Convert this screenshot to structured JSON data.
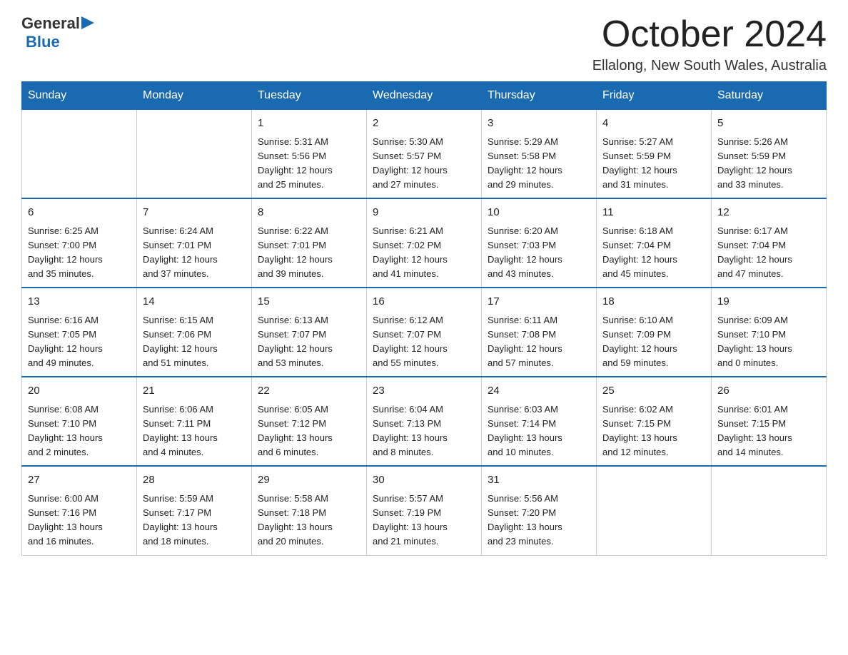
{
  "header": {
    "logo": {
      "general": "General",
      "arrow": "▶",
      "blue": "Blue"
    },
    "month_title": "October 2024",
    "location": "Ellalong, New South Wales, Australia"
  },
  "days_of_week": [
    "Sunday",
    "Monday",
    "Tuesday",
    "Wednesday",
    "Thursday",
    "Friday",
    "Saturday"
  ],
  "weeks": [
    [
      {
        "day": "",
        "info": ""
      },
      {
        "day": "",
        "info": ""
      },
      {
        "day": "1",
        "info": "Sunrise: 5:31 AM\nSunset: 5:56 PM\nDaylight: 12 hours\nand 25 minutes."
      },
      {
        "day": "2",
        "info": "Sunrise: 5:30 AM\nSunset: 5:57 PM\nDaylight: 12 hours\nand 27 minutes."
      },
      {
        "day": "3",
        "info": "Sunrise: 5:29 AM\nSunset: 5:58 PM\nDaylight: 12 hours\nand 29 minutes."
      },
      {
        "day": "4",
        "info": "Sunrise: 5:27 AM\nSunset: 5:59 PM\nDaylight: 12 hours\nand 31 minutes."
      },
      {
        "day": "5",
        "info": "Sunrise: 5:26 AM\nSunset: 5:59 PM\nDaylight: 12 hours\nand 33 minutes."
      }
    ],
    [
      {
        "day": "6",
        "info": "Sunrise: 6:25 AM\nSunset: 7:00 PM\nDaylight: 12 hours\nand 35 minutes."
      },
      {
        "day": "7",
        "info": "Sunrise: 6:24 AM\nSunset: 7:01 PM\nDaylight: 12 hours\nand 37 minutes."
      },
      {
        "day": "8",
        "info": "Sunrise: 6:22 AM\nSunset: 7:01 PM\nDaylight: 12 hours\nand 39 minutes."
      },
      {
        "day": "9",
        "info": "Sunrise: 6:21 AM\nSunset: 7:02 PM\nDaylight: 12 hours\nand 41 minutes."
      },
      {
        "day": "10",
        "info": "Sunrise: 6:20 AM\nSunset: 7:03 PM\nDaylight: 12 hours\nand 43 minutes."
      },
      {
        "day": "11",
        "info": "Sunrise: 6:18 AM\nSunset: 7:04 PM\nDaylight: 12 hours\nand 45 minutes."
      },
      {
        "day": "12",
        "info": "Sunrise: 6:17 AM\nSunset: 7:04 PM\nDaylight: 12 hours\nand 47 minutes."
      }
    ],
    [
      {
        "day": "13",
        "info": "Sunrise: 6:16 AM\nSunset: 7:05 PM\nDaylight: 12 hours\nand 49 minutes."
      },
      {
        "day": "14",
        "info": "Sunrise: 6:15 AM\nSunset: 7:06 PM\nDaylight: 12 hours\nand 51 minutes."
      },
      {
        "day": "15",
        "info": "Sunrise: 6:13 AM\nSunset: 7:07 PM\nDaylight: 12 hours\nand 53 minutes."
      },
      {
        "day": "16",
        "info": "Sunrise: 6:12 AM\nSunset: 7:07 PM\nDaylight: 12 hours\nand 55 minutes."
      },
      {
        "day": "17",
        "info": "Sunrise: 6:11 AM\nSunset: 7:08 PM\nDaylight: 12 hours\nand 57 minutes."
      },
      {
        "day": "18",
        "info": "Sunrise: 6:10 AM\nSunset: 7:09 PM\nDaylight: 12 hours\nand 59 minutes."
      },
      {
        "day": "19",
        "info": "Sunrise: 6:09 AM\nSunset: 7:10 PM\nDaylight: 13 hours\nand 0 minutes."
      }
    ],
    [
      {
        "day": "20",
        "info": "Sunrise: 6:08 AM\nSunset: 7:10 PM\nDaylight: 13 hours\nand 2 minutes."
      },
      {
        "day": "21",
        "info": "Sunrise: 6:06 AM\nSunset: 7:11 PM\nDaylight: 13 hours\nand 4 minutes."
      },
      {
        "day": "22",
        "info": "Sunrise: 6:05 AM\nSunset: 7:12 PM\nDaylight: 13 hours\nand 6 minutes."
      },
      {
        "day": "23",
        "info": "Sunrise: 6:04 AM\nSunset: 7:13 PM\nDaylight: 13 hours\nand 8 minutes."
      },
      {
        "day": "24",
        "info": "Sunrise: 6:03 AM\nSunset: 7:14 PM\nDaylight: 13 hours\nand 10 minutes."
      },
      {
        "day": "25",
        "info": "Sunrise: 6:02 AM\nSunset: 7:15 PM\nDaylight: 13 hours\nand 12 minutes."
      },
      {
        "day": "26",
        "info": "Sunrise: 6:01 AM\nSunset: 7:15 PM\nDaylight: 13 hours\nand 14 minutes."
      }
    ],
    [
      {
        "day": "27",
        "info": "Sunrise: 6:00 AM\nSunset: 7:16 PM\nDaylight: 13 hours\nand 16 minutes."
      },
      {
        "day": "28",
        "info": "Sunrise: 5:59 AM\nSunset: 7:17 PM\nDaylight: 13 hours\nand 18 minutes."
      },
      {
        "day": "29",
        "info": "Sunrise: 5:58 AM\nSunset: 7:18 PM\nDaylight: 13 hours\nand 20 minutes."
      },
      {
        "day": "30",
        "info": "Sunrise: 5:57 AM\nSunset: 7:19 PM\nDaylight: 13 hours\nand 21 minutes."
      },
      {
        "day": "31",
        "info": "Sunrise: 5:56 AM\nSunset: 7:20 PM\nDaylight: 13 hours\nand 23 minutes."
      },
      {
        "day": "",
        "info": ""
      },
      {
        "day": "",
        "info": ""
      }
    ]
  ]
}
